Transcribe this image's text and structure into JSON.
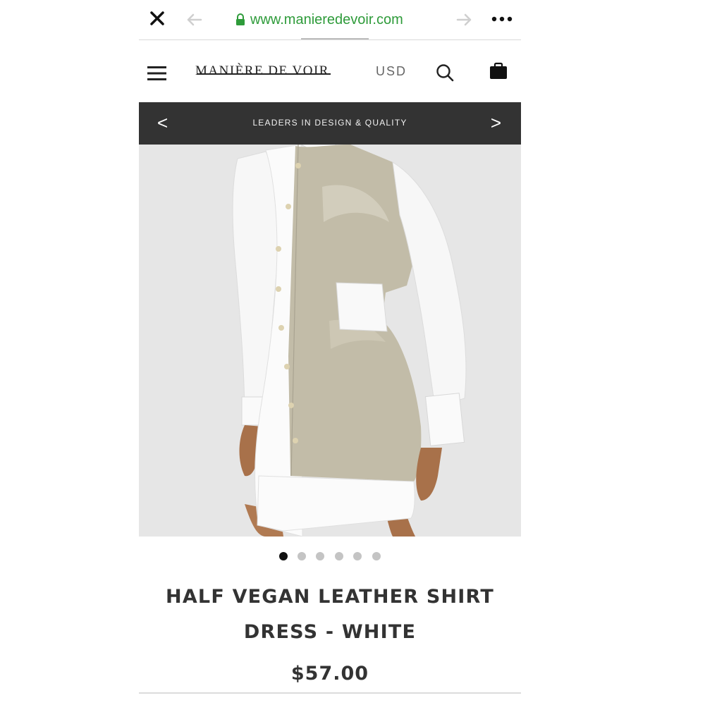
{
  "browser": {
    "url": "www.manieredevoir.com",
    "close_icon": "close-icon",
    "back_icon": "arrow-left-icon",
    "forward_icon": "arrow-right-icon",
    "more_icon": "more-horizontal-icon",
    "lock_icon": "lock-icon",
    "url_color": "#2e9b3a"
  },
  "header": {
    "logo": "MANIÈRE DE VOIR",
    "currency": "USD",
    "menu_icon": "hamburger-menu-icon",
    "search_icon": "search-icon",
    "bag_icon": "shopping-bag-icon"
  },
  "banner": {
    "message": "LEADERS IN DESIGN & QUALITY",
    "prev_label": "<",
    "next_label": ">",
    "background": "#333333"
  },
  "gallery": {
    "image_description_icon": "product-photo",
    "dot_count": 6,
    "active_index": 0
  },
  "product": {
    "title": "HALF VEGAN LEATHER SHIRT DRESS - WHITE",
    "price": "$57.00"
  }
}
